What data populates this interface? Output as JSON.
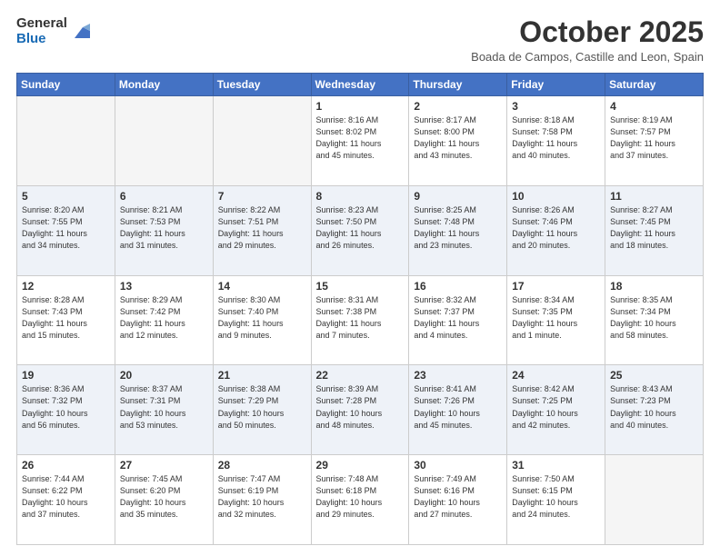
{
  "logo": {
    "general": "General",
    "blue": "Blue"
  },
  "header": {
    "month": "October 2025",
    "location": "Boada de Campos, Castille and Leon, Spain"
  },
  "weekdays": [
    "Sunday",
    "Monday",
    "Tuesday",
    "Wednesday",
    "Thursday",
    "Friday",
    "Saturday"
  ],
  "weeks": [
    [
      {
        "day": "",
        "info": ""
      },
      {
        "day": "",
        "info": ""
      },
      {
        "day": "",
        "info": ""
      },
      {
        "day": "1",
        "info": "Sunrise: 8:16 AM\nSunset: 8:02 PM\nDaylight: 11 hours\nand 45 minutes."
      },
      {
        "day": "2",
        "info": "Sunrise: 8:17 AM\nSunset: 8:00 PM\nDaylight: 11 hours\nand 43 minutes."
      },
      {
        "day": "3",
        "info": "Sunrise: 8:18 AM\nSunset: 7:58 PM\nDaylight: 11 hours\nand 40 minutes."
      },
      {
        "day": "4",
        "info": "Sunrise: 8:19 AM\nSunset: 7:57 PM\nDaylight: 11 hours\nand 37 minutes."
      }
    ],
    [
      {
        "day": "5",
        "info": "Sunrise: 8:20 AM\nSunset: 7:55 PM\nDaylight: 11 hours\nand 34 minutes."
      },
      {
        "day": "6",
        "info": "Sunrise: 8:21 AM\nSunset: 7:53 PM\nDaylight: 11 hours\nand 31 minutes."
      },
      {
        "day": "7",
        "info": "Sunrise: 8:22 AM\nSunset: 7:51 PM\nDaylight: 11 hours\nand 29 minutes."
      },
      {
        "day": "8",
        "info": "Sunrise: 8:23 AM\nSunset: 7:50 PM\nDaylight: 11 hours\nand 26 minutes."
      },
      {
        "day": "9",
        "info": "Sunrise: 8:25 AM\nSunset: 7:48 PM\nDaylight: 11 hours\nand 23 minutes."
      },
      {
        "day": "10",
        "info": "Sunrise: 8:26 AM\nSunset: 7:46 PM\nDaylight: 11 hours\nand 20 minutes."
      },
      {
        "day": "11",
        "info": "Sunrise: 8:27 AM\nSunset: 7:45 PM\nDaylight: 11 hours\nand 18 minutes."
      }
    ],
    [
      {
        "day": "12",
        "info": "Sunrise: 8:28 AM\nSunset: 7:43 PM\nDaylight: 11 hours\nand 15 minutes."
      },
      {
        "day": "13",
        "info": "Sunrise: 8:29 AM\nSunset: 7:42 PM\nDaylight: 11 hours\nand 12 minutes."
      },
      {
        "day": "14",
        "info": "Sunrise: 8:30 AM\nSunset: 7:40 PM\nDaylight: 11 hours\nand 9 minutes."
      },
      {
        "day": "15",
        "info": "Sunrise: 8:31 AM\nSunset: 7:38 PM\nDaylight: 11 hours\nand 7 minutes."
      },
      {
        "day": "16",
        "info": "Sunrise: 8:32 AM\nSunset: 7:37 PM\nDaylight: 11 hours\nand 4 minutes."
      },
      {
        "day": "17",
        "info": "Sunrise: 8:34 AM\nSunset: 7:35 PM\nDaylight: 11 hours\nand 1 minute."
      },
      {
        "day": "18",
        "info": "Sunrise: 8:35 AM\nSunset: 7:34 PM\nDaylight: 10 hours\nand 58 minutes."
      }
    ],
    [
      {
        "day": "19",
        "info": "Sunrise: 8:36 AM\nSunset: 7:32 PM\nDaylight: 10 hours\nand 56 minutes."
      },
      {
        "day": "20",
        "info": "Sunrise: 8:37 AM\nSunset: 7:31 PM\nDaylight: 10 hours\nand 53 minutes."
      },
      {
        "day": "21",
        "info": "Sunrise: 8:38 AM\nSunset: 7:29 PM\nDaylight: 10 hours\nand 50 minutes."
      },
      {
        "day": "22",
        "info": "Sunrise: 8:39 AM\nSunset: 7:28 PM\nDaylight: 10 hours\nand 48 minutes."
      },
      {
        "day": "23",
        "info": "Sunrise: 8:41 AM\nSunset: 7:26 PM\nDaylight: 10 hours\nand 45 minutes."
      },
      {
        "day": "24",
        "info": "Sunrise: 8:42 AM\nSunset: 7:25 PM\nDaylight: 10 hours\nand 42 minutes."
      },
      {
        "day": "25",
        "info": "Sunrise: 8:43 AM\nSunset: 7:23 PM\nDaylight: 10 hours\nand 40 minutes."
      }
    ],
    [
      {
        "day": "26",
        "info": "Sunrise: 7:44 AM\nSunset: 6:22 PM\nDaylight: 10 hours\nand 37 minutes."
      },
      {
        "day": "27",
        "info": "Sunrise: 7:45 AM\nSunset: 6:20 PM\nDaylight: 10 hours\nand 35 minutes."
      },
      {
        "day": "28",
        "info": "Sunrise: 7:47 AM\nSunset: 6:19 PM\nDaylight: 10 hours\nand 32 minutes."
      },
      {
        "day": "29",
        "info": "Sunrise: 7:48 AM\nSunset: 6:18 PM\nDaylight: 10 hours\nand 29 minutes."
      },
      {
        "day": "30",
        "info": "Sunrise: 7:49 AM\nSunset: 6:16 PM\nDaylight: 10 hours\nand 27 minutes."
      },
      {
        "day": "31",
        "info": "Sunrise: 7:50 AM\nSunset: 6:15 PM\nDaylight: 10 hours\nand 24 minutes."
      },
      {
        "day": "",
        "info": ""
      }
    ]
  ]
}
